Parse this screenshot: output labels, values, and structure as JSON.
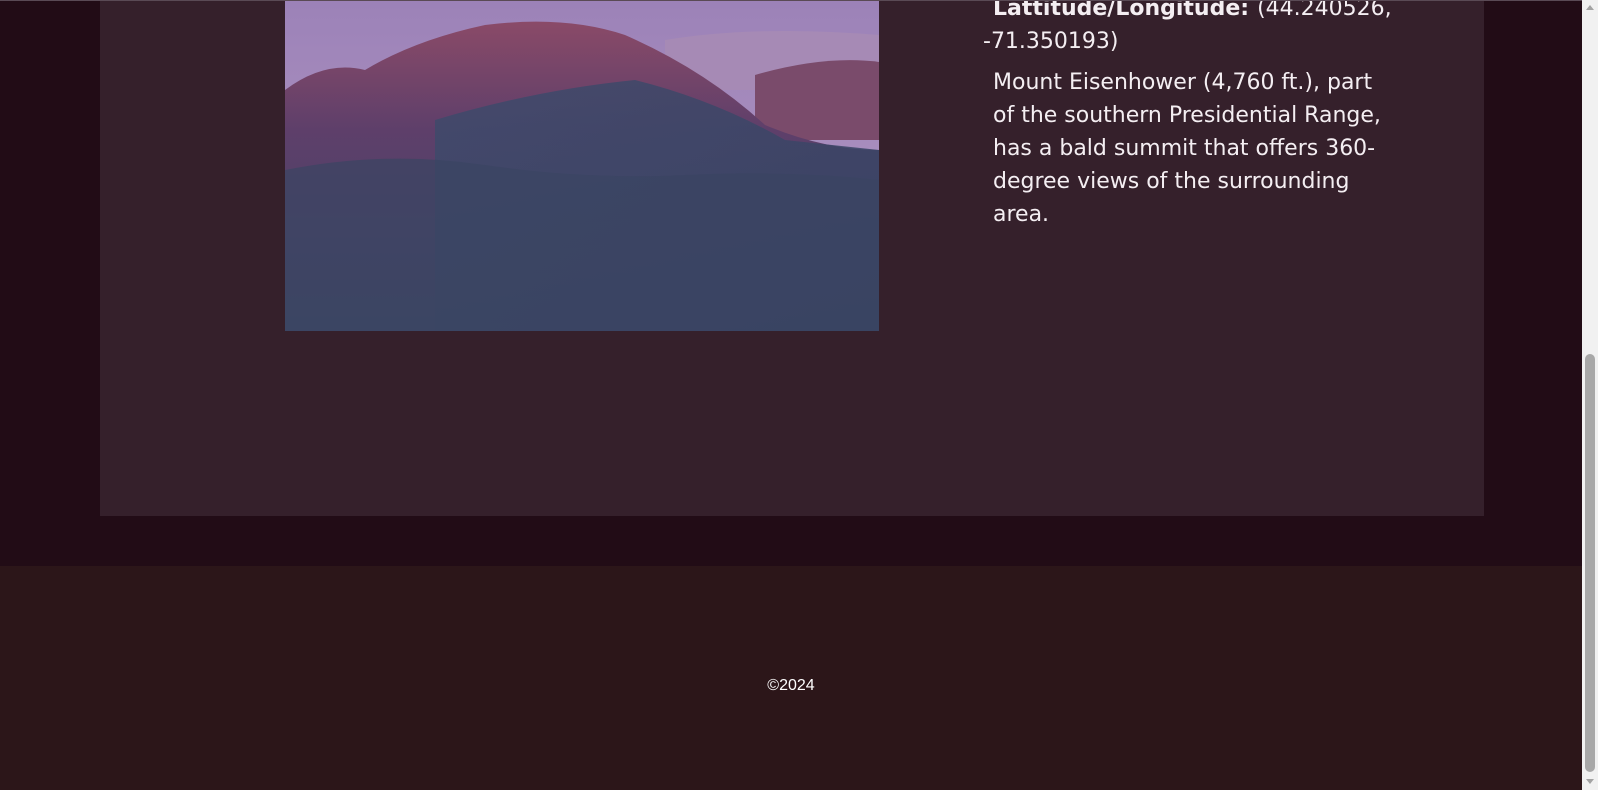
{
  "mountain": {
    "image_alt": "Mount Eisenhower summit",
    "coords_label": "Lattitude/Longitude:",
    "coords_value": "(44.240526, -71.350193)",
    "description": "Mount Eisenhower (4,760 ft.), part of the southern Presidential Range, has a bald summit that offers 360-degree views of the surrounding area."
  },
  "footer": {
    "copyright": "©2024"
  },
  "colors": {
    "page_bg": "#220c16",
    "card_bg": "#35202b",
    "footer_bg": "#2c1619",
    "text": "#f4eef2"
  },
  "icons": {
    "scroll_up": "scroll-up-arrow-icon",
    "scroll_down": "scroll-down-arrow-icon"
  }
}
